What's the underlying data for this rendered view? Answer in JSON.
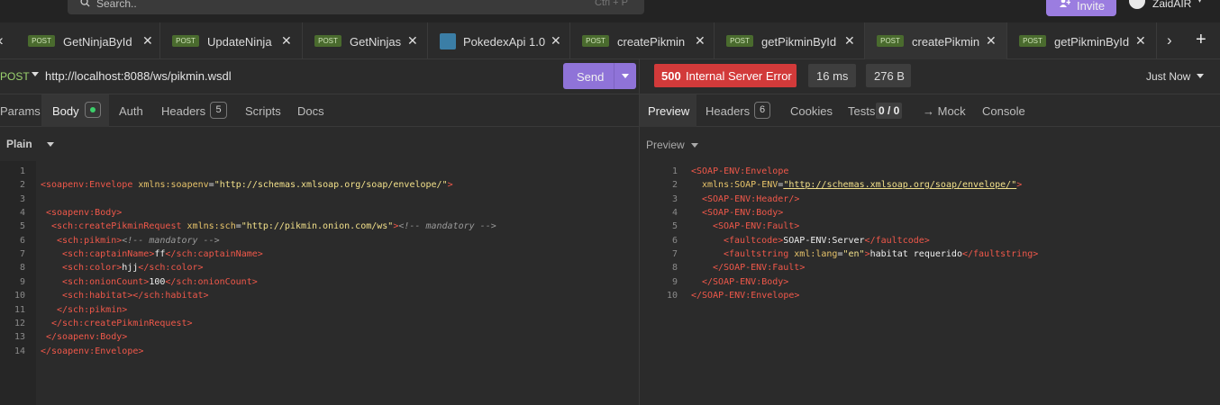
{
  "topbar": {
    "search_placeholder": "Search..",
    "search_shortcut": "Ctrl + P",
    "invite_label": "Invite",
    "user_name": "ZaidAIR"
  },
  "tabs": [
    {
      "method": "POST",
      "label": "GetNinjaById"
    },
    {
      "method": "POST",
      "label": "UpdateNinja"
    },
    {
      "method": "POST",
      "label": "GetNinjas"
    },
    {
      "method": "",
      "label": "PokedexApi 1.0"
    },
    {
      "method": "POST",
      "label": "createPikmin"
    },
    {
      "method": "POST",
      "label": "getPikminById"
    },
    {
      "method": "POST",
      "label": "createPikmin"
    },
    {
      "method": "POST",
      "label": "getPikminById"
    }
  ],
  "request": {
    "method": "POST",
    "url": "http://localhost:8088/ws/pikmin.wsdl",
    "send_label": "Send",
    "subtabs": {
      "params": "Params",
      "body": "Body",
      "auth": "Auth",
      "headers": "Headers",
      "headers_count": "5",
      "scripts": "Scripts",
      "docs": "Docs"
    },
    "body_type": "Plain"
  },
  "response": {
    "status_code": "500",
    "status_text": "Internal Server Error",
    "time": "16 ms",
    "size": "276 B",
    "when": "Just Now",
    "subtabs": {
      "preview": "Preview",
      "headers": "Headers",
      "headers_count": "6",
      "cookies": "Cookies",
      "tests": "Tests",
      "tests_count": "0 / 0",
      "mock": "→ Mock",
      "console": "Console"
    },
    "preview_mode": "Preview"
  },
  "request_lines": [
    "1",
    "2",
    "3",
    "4",
    "5",
    "6",
    "7",
    "8",
    "9",
    "10",
    "11",
    "12",
    "13",
    "14"
  ],
  "response_lines": [
    "1",
    "2",
    "3",
    "4",
    "5",
    "6",
    "7",
    "8",
    "9",
    "10"
  ],
  "request_body": {
    "l2": {
      "tag": "<soapenv:Envelope",
      "attr": "xmlns:soapenv",
      "val": "\"http://schemas.xmlsoap.org/soap/envelope/\"",
      "close": ">"
    },
    "l4": "<soapenv:Body>",
    "l5": {
      "tag": "<sch:createPikminRequest",
      "attr": "xmlns:sch",
      "val": "\"http://pikmin.onion.com/ws\"",
      "close": ">",
      "cmt": "<!-- mandatory -->"
    },
    "l6": {
      "tag": "<sch:pikmin>",
      "cmt": "<!-- mandatory -->"
    },
    "l7": {
      "open": "<sch:captainName>",
      "text": "ff",
      "close": "</sch:captainName>"
    },
    "l8": {
      "open": "<sch:color>",
      "text": "hjj",
      "close": "</sch:color>"
    },
    "l9": {
      "open": "<sch:onionCount>",
      "text": "100",
      "close": "</sch:onionCount>"
    },
    "l10": {
      "open": "<sch:habitat>",
      "close": "</sch:habitat>"
    },
    "l11": "</sch:pikmin>",
    "l12": "</sch:createPikminRequest>",
    "l13": "</soapenv:Body>",
    "l14": "</soapenv:Envelope>"
  },
  "response_body": {
    "l1": "<SOAP-ENV:Envelope",
    "l2": {
      "attr": "xmlns:SOAP-ENV",
      "val": "\"http://schemas.xmlsoap.org/soap/envelope/\"",
      "close": ">"
    },
    "l3": "<SOAP-ENV:Header/>",
    "l4": "<SOAP-ENV:Body>",
    "l5": "<SOAP-ENV:Fault>",
    "l6": {
      "open": "<faultcode>",
      "text": "SOAP-ENV:Server",
      "close": "</faultcode>"
    },
    "l7": {
      "open": "<faultstring",
      "attr": "xml:lang",
      "val": "\"en\"",
      "gt": ">",
      "text": "habitat requerido",
      "close": "</faultstring>"
    },
    "l8": "</SOAP-ENV:Fault>",
    "l9": "</SOAP-ENV:Body>",
    "l10": "</SOAP-ENV:Envelope>"
  },
  "colors": {
    "accent": "#8f73d8",
    "error": "#d23a3a",
    "post_badge": "#4a6b2e",
    "xml_tag": "#f0584a",
    "xml_string": "#f2e08a"
  }
}
